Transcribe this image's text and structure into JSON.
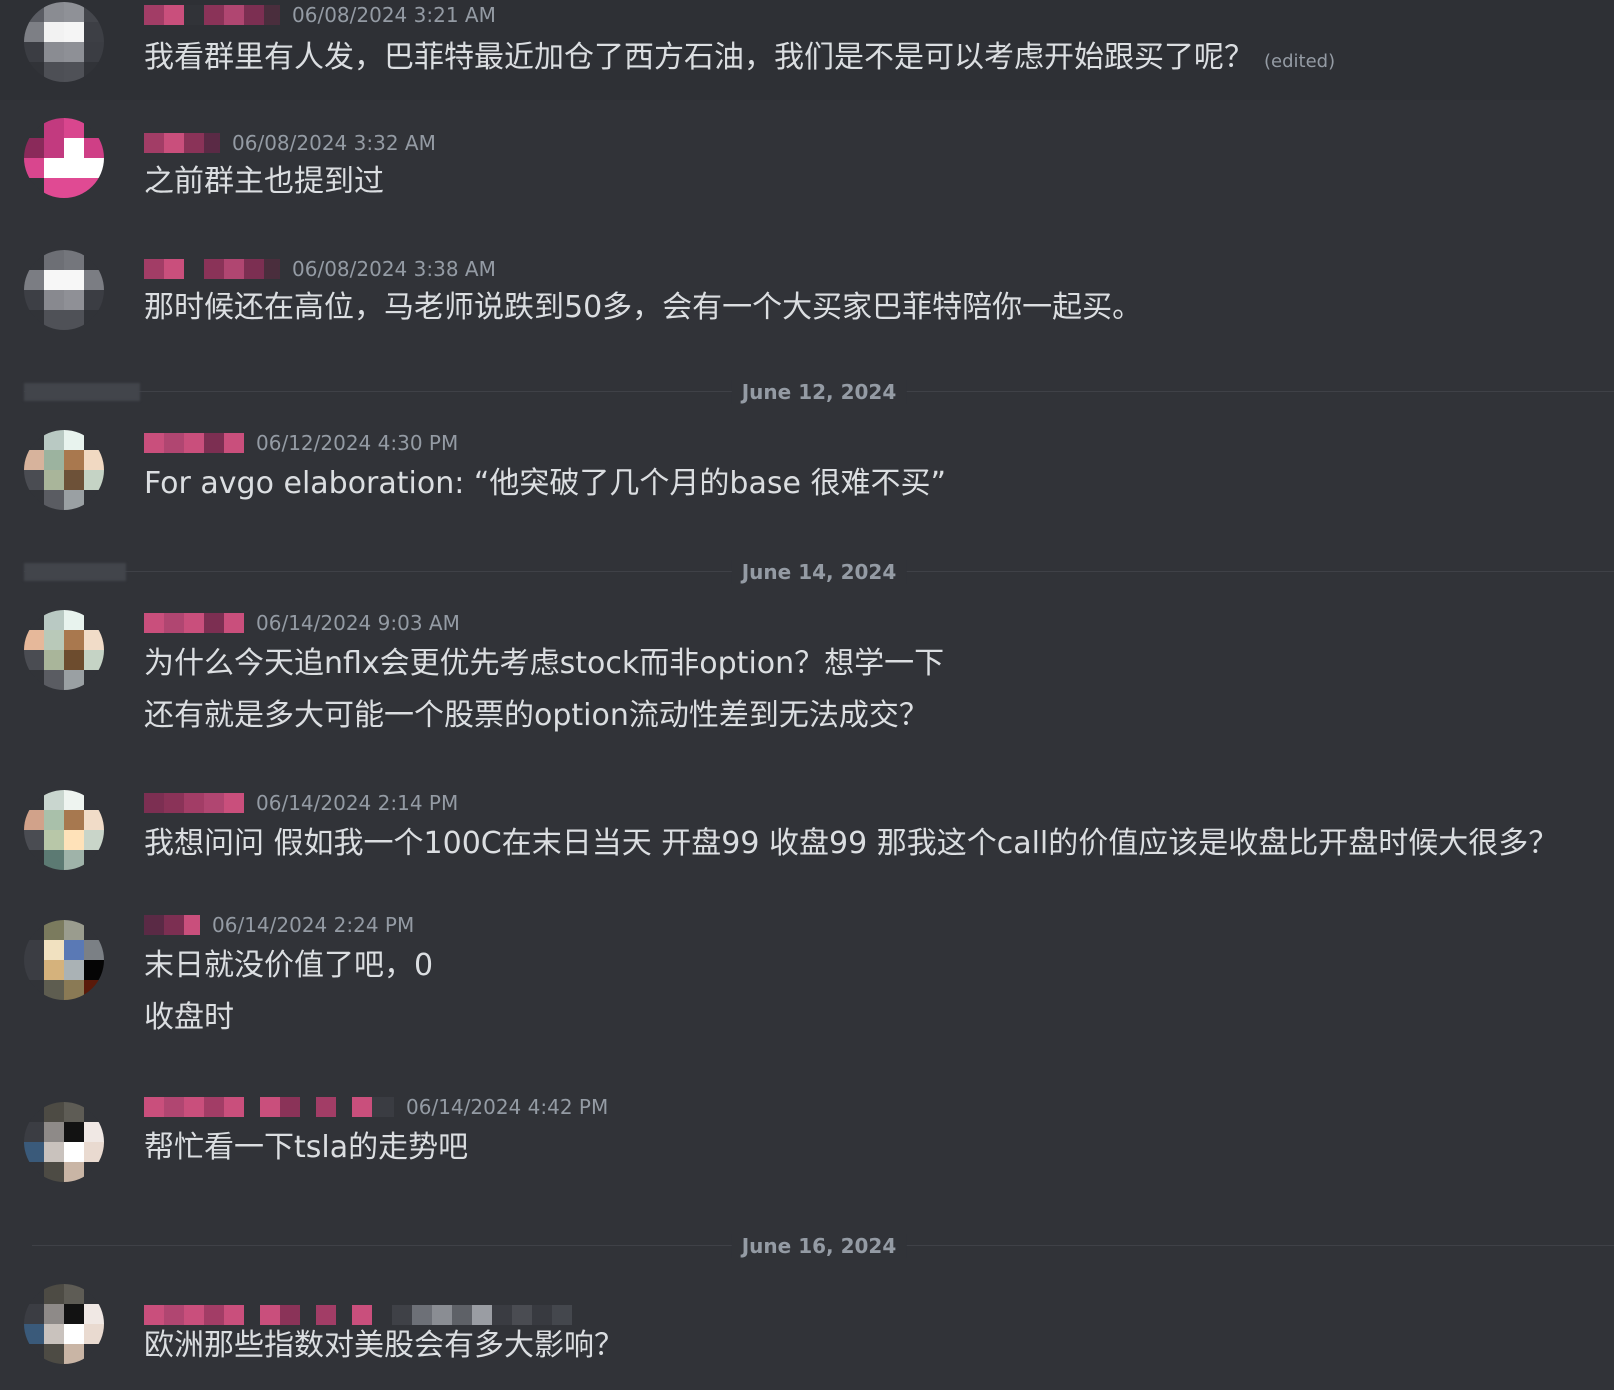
{
  "messages": [
    {
      "timestamp": "06/08/2024 3:21 AM",
      "lines": [
        "我看群里有人发，巴菲特最近加仓了西方石油，我们是不是可以考虑开始跟买了呢？"
      ],
      "edited": "(edited)"
    },
    {
      "timestamp": "06/08/2024 3:32 AM",
      "lines": [
        "之前群主也提到过"
      ]
    },
    {
      "timestamp": "06/08/2024 3:38 AM",
      "lines": [
        "那时候还在高位，马老师说跌到50多，会有一个大买家巴菲特陪你一起买。"
      ]
    },
    {
      "timestamp": "06/12/2024 4:30 PM",
      "lines": [
        "For avgo elaboration: “他突破了几个月的base 很难不买”"
      ]
    },
    {
      "timestamp": "06/14/2024 9:03 AM",
      "lines": [
        "为什么今天追nflx会更优先考虑stock而非option？想学一下",
        "还有就是多大可能一个股票的option流动性差到无法成交？"
      ]
    },
    {
      "timestamp": "06/14/2024 2:14 PM",
      "lines": [
        "我想问问 假如我一个100C在末日当天 开盘99 收盘99 那我这个call的价值应该是收盘比开盘时候大很多？"
      ]
    },
    {
      "timestamp": "06/14/2024 2:24 PM",
      "lines": [
        "末日就没价值了吧，0",
        "收盘时"
      ]
    },
    {
      "timestamp": "06/14/2024 4:42 PM",
      "lines": [
        "帮忙看一下tsla的走势吧"
      ]
    },
    {
      "timestamp": "",
      "lines": [
        "欧洲那些指数对美股会有多大影响？"
      ]
    }
  ],
  "dividers": [
    {
      "label": "June 12, 2024"
    },
    {
      "label": "June 14, 2024"
    },
    {
      "label": "June 16, 2024"
    }
  ],
  "colors": {
    "background": "#313338",
    "text": "#dbdee1",
    "muted": "#949ba4",
    "divider_line": "#3f4147",
    "redacted_name": "#c94f7c"
  }
}
